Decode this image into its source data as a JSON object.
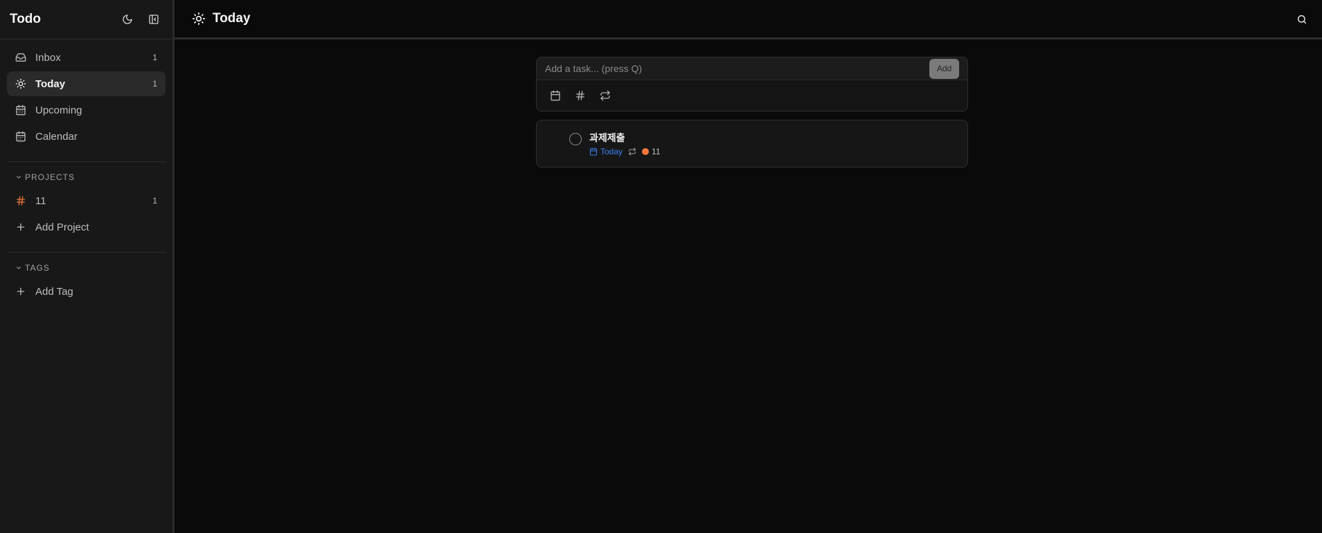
{
  "sidebar": {
    "app_title": "Todo",
    "nav": [
      {
        "label": "Inbox",
        "count": "1"
      },
      {
        "label": "Today",
        "count": "1"
      },
      {
        "label": "Upcoming",
        "count": ""
      },
      {
        "label": "Calendar",
        "count": ""
      }
    ],
    "projects": {
      "heading": "PROJECTS",
      "items": [
        {
          "label": "11",
          "count": "1"
        }
      ],
      "add_label": "Add Project"
    },
    "tags": {
      "heading": "TAGS",
      "add_label": "Add Tag"
    }
  },
  "header": {
    "title": "Today"
  },
  "add_task": {
    "placeholder": "Add a task... (press Q)",
    "value": "",
    "add_label": "Add"
  },
  "tasks": [
    {
      "title": "과제제출",
      "due": "Today",
      "project": "11"
    }
  ],
  "colors": {
    "accent_blue": "#3b82f6",
    "project_orange": "#f0783c"
  },
  "icons": {
    "theme": "moon-icon",
    "sidebar_toggle": "sidebar-collapse-icon",
    "search": "search-icon"
  }
}
